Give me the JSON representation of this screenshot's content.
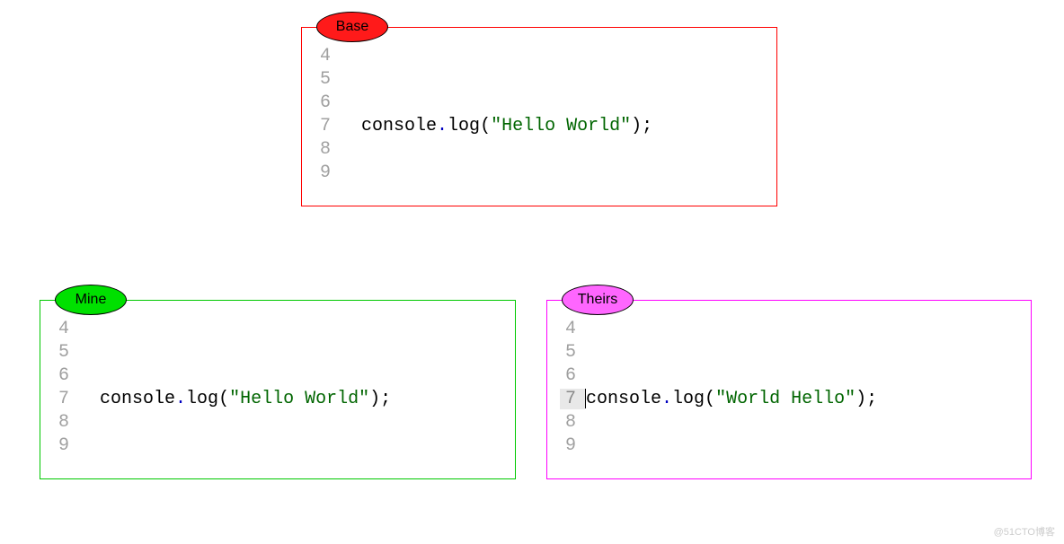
{
  "base": {
    "label": "Base",
    "lines": [
      {
        "num": "4",
        "obj": "",
        "dot": "",
        "method": "",
        "open": "",
        "str": "",
        "close": "",
        "semi": "",
        "hl": false,
        "cursor": false
      },
      {
        "num": "5",
        "obj": "",
        "dot": "",
        "method": "",
        "open": "",
        "str": "",
        "close": "",
        "semi": "",
        "hl": false,
        "cursor": false
      },
      {
        "num": "6",
        "obj": "",
        "dot": "",
        "method": "",
        "open": "",
        "str": "",
        "close": "",
        "semi": "",
        "hl": false,
        "cursor": false
      },
      {
        "num": "7",
        "obj": "console",
        "dot": ".",
        "method": "log",
        "open": "(",
        "str": "\"Hello World\"",
        "close": ")",
        "semi": ";",
        "hl": false,
        "cursor": false
      },
      {
        "num": "8",
        "obj": "",
        "dot": "",
        "method": "",
        "open": "",
        "str": "",
        "close": "",
        "semi": "",
        "hl": false,
        "cursor": false
      },
      {
        "num": "9",
        "obj": "",
        "dot": "",
        "method": "",
        "open": "",
        "str": "",
        "close": "",
        "semi": "",
        "hl": false,
        "cursor": false
      }
    ]
  },
  "mine": {
    "label": "Mine",
    "lines": [
      {
        "num": "4",
        "obj": "",
        "dot": "",
        "method": "",
        "open": "",
        "str": "",
        "close": "",
        "semi": "",
        "hl": false,
        "cursor": false
      },
      {
        "num": "5",
        "obj": "",
        "dot": "",
        "method": "",
        "open": "",
        "str": "",
        "close": "",
        "semi": "",
        "hl": false,
        "cursor": false
      },
      {
        "num": "6",
        "obj": "",
        "dot": "",
        "method": "",
        "open": "",
        "str": "",
        "close": "",
        "semi": "",
        "hl": false,
        "cursor": false
      },
      {
        "num": "7",
        "obj": "console",
        "dot": ".",
        "method": "log",
        "open": "(",
        "str": "\"Hello World\"",
        "close": ")",
        "semi": ";",
        "hl": false,
        "cursor": false
      },
      {
        "num": "8",
        "obj": "",
        "dot": "",
        "method": "",
        "open": "",
        "str": "",
        "close": "",
        "semi": "",
        "hl": false,
        "cursor": false
      },
      {
        "num": "9",
        "obj": "",
        "dot": "",
        "method": "",
        "open": "",
        "str": "",
        "close": "",
        "semi": "",
        "hl": false,
        "cursor": false
      }
    ]
  },
  "theirs": {
    "label": "Theirs",
    "lines": [
      {
        "num": "4",
        "obj": "",
        "dot": "",
        "method": "",
        "open": "",
        "str": "",
        "close": "",
        "semi": "",
        "hl": false,
        "cursor": false
      },
      {
        "num": "5",
        "obj": "",
        "dot": "",
        "method": "",
        "open": "",
        "str": "",
        "close": "",
        "semi": "",
        "hl": false,
        "cursor": false
      },
      {
        "num": "6",
        "obj": "",
        "dot": "",
        "method": "",
        "open": "",
        "str": "",
        "close": "",
        "semi": "",
        "hl": false,
        "cursor": false
      },
      {
        "num": "7",
        "obj": "console",
        "dot": ".",
        "method": "log",
        "open": "(",
        "str": "\"World Hello\"",
        "close": ")",
        "semi": ";",
        "hl": true,
        "cursor": true
      },
      {
        "num": "8",
        "obj": "",
        "dot": "",
        "method": "",
        "open": "",
        "str": "",
        "close": "",
        "semi": "",
        "hl": false,
        "cursor": false
      },
      {
        "num": "9",
        "obj": "",
        "dot": "",
        "method": "",
        "open": "",
        "str": "",
        "close": "",
        "semi": "",
        "hl": false,
        "cursor": false
      }
    ]
  },
  "watermark": "@51CTO博客"
}
